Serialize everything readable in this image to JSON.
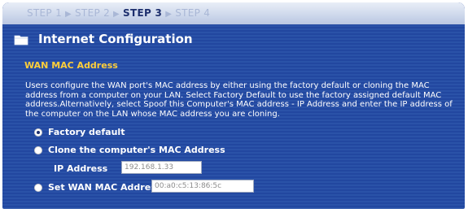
{
  "steps": {
    "step1": "STEP 1",
    "step2": "STEP 2",
    "step3": "STEP 3",
    "step4": "STEP 4",
    "separator": "▶"
  },
  "header": {
    "title": "Internet Configuration",
    "icon": "folder-icon"
  },
  "section": {
    "title": "WAN MAC Address",
    "description": "Users configure the WAN port's MAC address by either using the factory default or cloning the MAC address from a computer on your LAN. Select Factory Default to use the factory assigned default MAC address.Alternatively, select Spoof this Computer's MAC address - IP Address and enter the IP address of the computer on the LAN whose MAC address you are cloning."
  },
  "options": {
    "factory_default": {
      "label": "Factory default",
      "checked": true
    },
    "clone": {
      "label": "Clone the computer's MAC Address",
      "checked": false
    },
    "ip_address": {
      "label": "IP Address",
      "value": "192.168.1.33"
    },
    "set_wan": {
      "label": "Set WAN MAC Address",
      "value": "00:a0:c5:13:86:5c",
      "checked": false
    }
  },
  "colors": {
    "panel_bg": "#274ea3",
    "section_title": "#ffcf3a",
    "current_step": "#1d2f6e"
  }
}
